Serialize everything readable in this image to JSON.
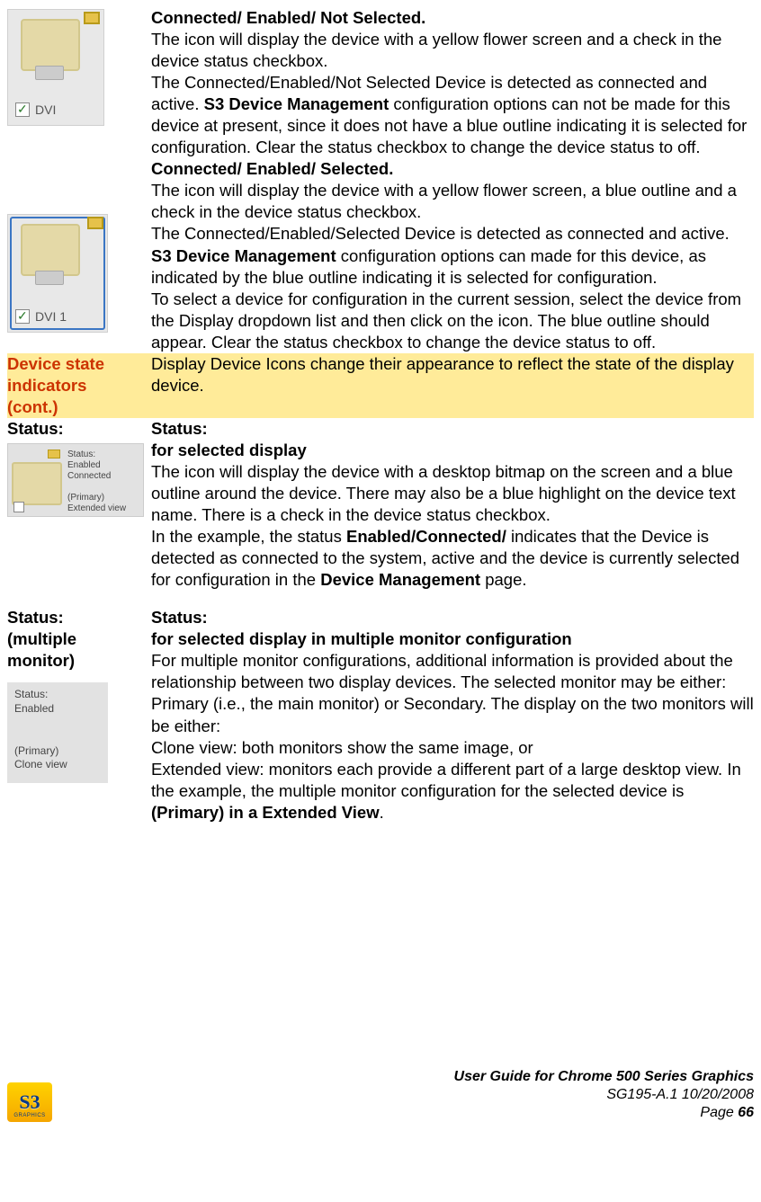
{
  "rows": [
    {
      "left_label1": "",
      "icon1_label": "DVI",
      "title1": "Connected/ Enabled/ Not Selected.",
      "p1": "The icon will display the device with a yellow flower screen and a check in the device status checkbox.",
      "p2a": "The Connected/Enabled/Not Selected Device is detected as connected and active. ",
      "p2_bold": "S3 Device Management",
      "p2b": " configuration options can not be made for this device at present, since it does not have a blue outline indicating it is selected for configuration. Clear the status checkbox to change the device status to off.",
      "icon2_label": "DVI 1",
      "title2": "Connected/ Enabled/ Selected.",
      "p3": "The icon will display the device with a yellow flower screen, a blue outline and a check in the device status checkbox.",
      "p4a": "The Connected/Enabled/Selected Device is detected as connected and active. ",
      "p4_bold": "S3 Device Management",
      "p4b": " configuration options can made for this device, as indicated by the blue outline indicating it is selected for configuration.",
      "p5": "To select a device for configuration in the current session, select the device from the Display dropdown list and then click on the icon. The blue outline should appear. Clear the status checkbox to change the device status to off."
    }
  ],
  "highlight": {
    "left1": "Device state indicators",
    "left2": "(cont.)",
    "right": "Display Device Icons change their appearance to reflect the state of the display device."
  },
  "status1": {
    "left_title": "Status:",
    "thumb_text": "Status:\nEnabled\nConnected\n\n(Primary)\nExtended view",
    "r_title": "Status:",
    "r_sub": "for selected display",
    "r_p1": "The icon will display the device with a desktop bitmap on the screen and a blue outline around the device. There may also be a blue highlight on the device text name. There is a check in the device status checkbox.",
    "r_p2a": "In the example, the status ",
    "r_p2_bold1": "Enabled/Connected/",
    "r_p2b": " indicates that the Device is detected as connected to the system, active and the device is currently selected for configuration in the ",
    "r_p2_bold2": "Device Management",
    "r_p2c": " page."
  },
  "status2": {
    "left_title": "Status:",
    "left_sub": "(multiple monitor)",
    "thumb_text": "Status:\nEnabled\n\n\n(Primary)\nClone view",
    "r_title": "Status:",
    "r_sub": "for selected display in multiple monitor configuration",
    "r_p1": "For multiple monitor configurations, additional information is provided about the relationship between two display devices. The selected monitor may be either: Primary (i.e., the main monitor) or Secondary. The display on the two monitors will be either:",
    "r_p2": "Clone view: both monitors show the same image, or",
    "r_p3a": "Extended view: monitors each provide a different part of a large desktop view. In the example, the multiple monitor configuration for the selected device is ",
    "r_p3_bold": "(Primary)  in a Extended View",
    "r_p3b": "."
  },
  "footer": {
    "logo_text": "S3",
    "logo_sub": "GRAPHICS",
    "line1": "User Guide for Chrome 500 Series Graphics",
    "line2": "SG195-A.1   10/20/2008",
    "page_label": "Page ",
    "page_num": "66"
  }
}
